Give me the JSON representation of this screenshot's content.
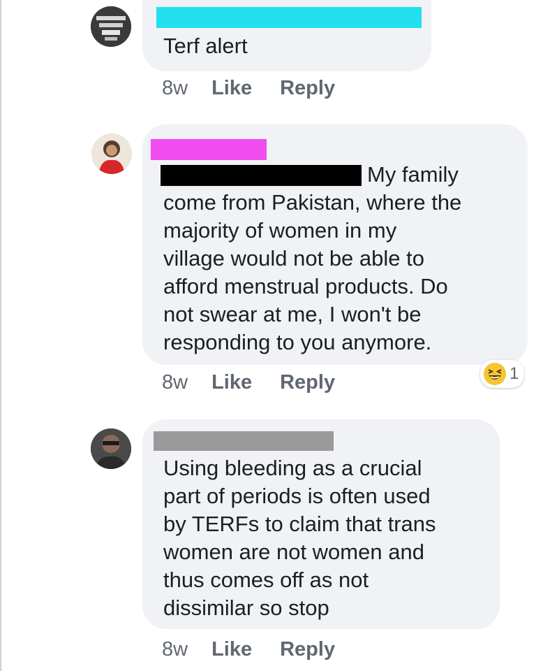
{
  "comments": [
    {
      "text": "Terf alert",
      "time": "8w",
      "like": "Like",
      "reply": "Reply",
      "name_redaction_color": "#22e0f0"
    },
    {
      "text_first_line": "My family",
      "text_rest": "come from Pakistan, where the\nmajority of women in my\nvillage would not be able to\nafford menstrual products. Do\nnot swear at me, I won't be\nresponding to you anymore.",
      "time": "8w",
      "like": "Like",
      "reply": "Reply",
      "name_redaction_color": "#f04cf0",
      "reaction_icon": "laughing-emoji-icon",
      "reaction_count": "1"
    },
    {
      "text": "Using bleeding as a crucial\npart of periods is often used\nby TERFs to claim that trans\nwomen are not women and\nthus comes off as not\ndissimilar so stop",
      "time": "8w",
      "like": "Like",
      "reply": "Reply",
      "name_redaction_color": "#9a9a9a"
    }
  ],
  "colors": {
    "bubble": "#f0f2f5",
    "meta_text": "#606770",
    "body_text": "#1c1e21"
  }
}
